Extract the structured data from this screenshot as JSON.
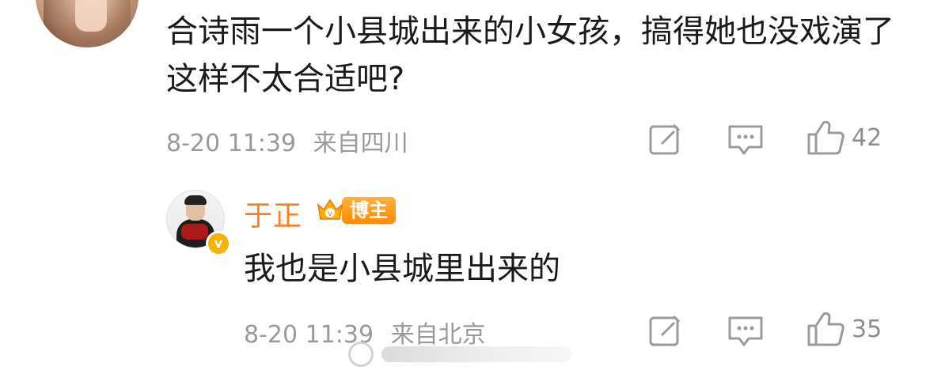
{
  "top_comment": {
    "text": "合诗雨一个小县城出来的小女孩，搞得她也没戏演了这样不太合适吧?",
    "date": "8-20 11:39",
    "location": "来自四川",
    "likes": "42",
    "icons": {
      "share": "share-icon",
      "comment": "comment-icon",
      "like": "thumbs-up-icon"
    }
  },
  "reply": {
    "username": "于正",
    "badge": "博主",
    "text": "我也是小县城里出来的",
    "date": "8-20 11:39",
    "location": "来自北京",
    "likes": "35",
    "verified_mark": "v"
  },
  "colors": {
    "username": "#ff7f1f",
    "badge_bg": "#ff8a00",
    "meta": "#9a9a9a",
    "icon": "#9b9b9b"
  }
}
